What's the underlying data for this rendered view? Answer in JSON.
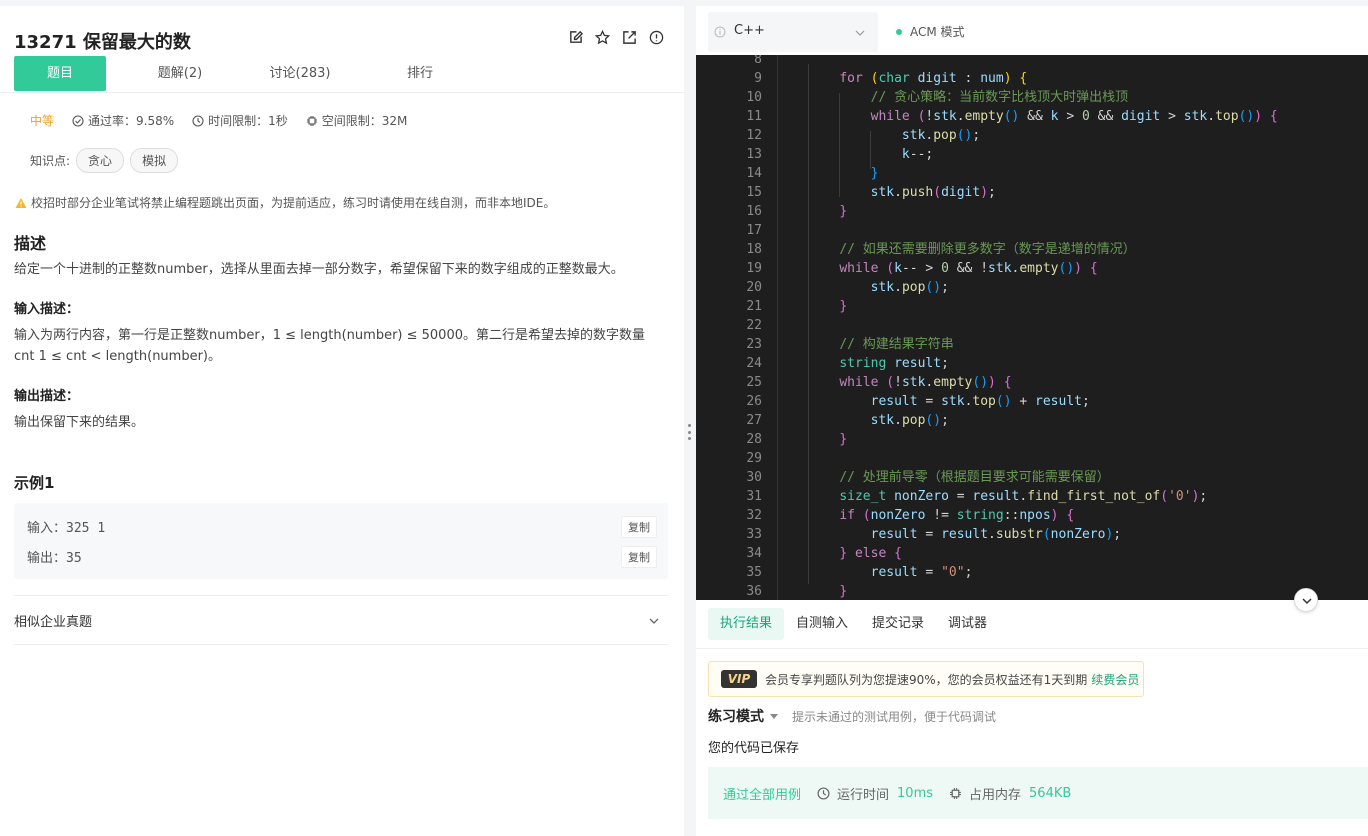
{
  "problem": {
    "title": "13271  保留最大的数",
    "tabs": [
      "题目",
      "题解(2)",
      "讨论(283)",
      "排行"
    ],
    "difficulty": "中等",
    "pass_rate": "通过率：9.58%",
    "time_limit": "时间限制：1秒",
    "space_limit": "空间限制：32M",
    "knowledge_label": "知识点:",
    "tags": [
      "贪心",
      "模拟"
    ],
    "notice": "校招时部分企业笔试将禁止编程题跳出页面，为提前适应，练习时请使用在线自测，而非本地IDE。",
    "desc_heading": "描述",
    "desc": "给定一个十进制的正整数number，选择从里面去掉一部分数字，希望保留下来的数字组成的正整数最大。",
    "input_heading": "输入描述：",
    "input_desc": "输入为两行内容，第一行是正整数number，1 ≤ length(number) ≤ 50000。第二行是希望去掉的数字数量cnt 1 ≤ cnt < length(number)。",
    "output_heading": "输出描述：",
    "output_desc": "输出保留下来的结果。",
    "example_heading": "示例1",
    "example": {
      "input_label": "输入：",
      "input_value": "325 1",
      "output_label": "输出：",
      "output_value": "35",
      "copy_label": "复制"
    },
    "similar_label": "相似企业真题"
  },
  "editor": {
    "language": "C++",
    "mode": "ACM 模式"
  },
  "bottom": {
    "tabs": [
      "执行结果",
      "自测输入",
      "提交记录",
      "调试器"
    ],
    "vip_badge": "VIP",
    "vip_text": "会员专享判题队列为您提速90%，您的会员权益还有1天到期",
    "vip_link": "续费会员",
    "mode_label": "练习模式",
    "mode_hint": "提示未通过的测试用例，便于代码调试",
    "saved": "您的代码已保存",
    "result_pass": "通过全部用例",
    "runtime_label": "运行时间",
    "runtime_value": "10ms",
    "memory_label": "占用内存",
    "memory_value": "564KB"
  },
  "colors": {
    "accent": "#32ca99",
    "editor_bg": "#1e1e1e",
    "difficulty": "#f0a020"
  }
}
